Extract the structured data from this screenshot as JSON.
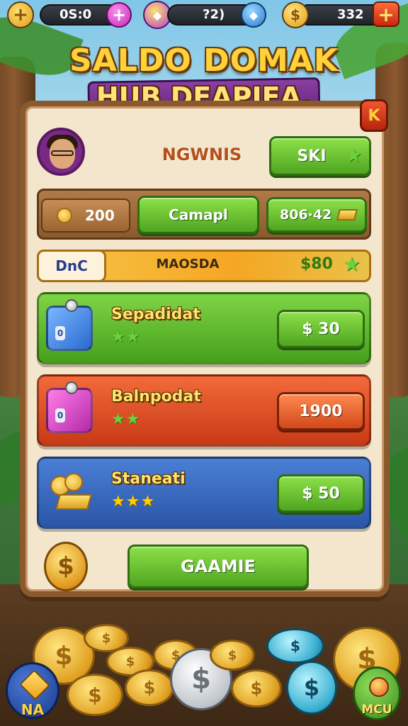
{
  "topbar": {
    "timer_value": "0S:0",
    "middle_value": "?2)",
    "coin_value": "332",
    "plus_label": "+",
    "add_label": "+"
  },
  "title": {
    "line1": "SALDO DOMAK",
    "line2": "HUB DEAPIEA."
  },
  "panel": {
    "close_label": "K",
    "player_name": "NGWNIS",
    "ski_button": "SKI",
    "stats": {
      "coins": "200",
      "campaign_button": "Camapl",
      "gold": "806·42"
    },
    "strip": {
      "tag": "DnC",
      "label": "MAOSDA",
      "price": "$80"
    },
    "offers": [
      {
        "name": "Sepadidat",
        "price": "$ 30",
        "stars": "★★",
        "color": "green"
      },
      {
        "name": "Balnpodat",
        "price": "1900",
        "stars": "★★",
        "color": "red"
      },
      {
        "name": "Staneati",
        "price": "$ 50",
        "stars": "★★★",
        "color": "blue"
      }
    ],
    "coin_symbol": "$",
    "game_button": "GAAMIE"
  },
  "bottom": {
    "na_label": "NA",
    "mcu_label": "MCU"
  },
  "colors": {
    "accent_gold": "#ffd23a",
    "green": "#4ea51f",
    "red": "#c83a16",
    "blue": "#2a56a8",
    "panel": "#f4e6cc"
  }
}
